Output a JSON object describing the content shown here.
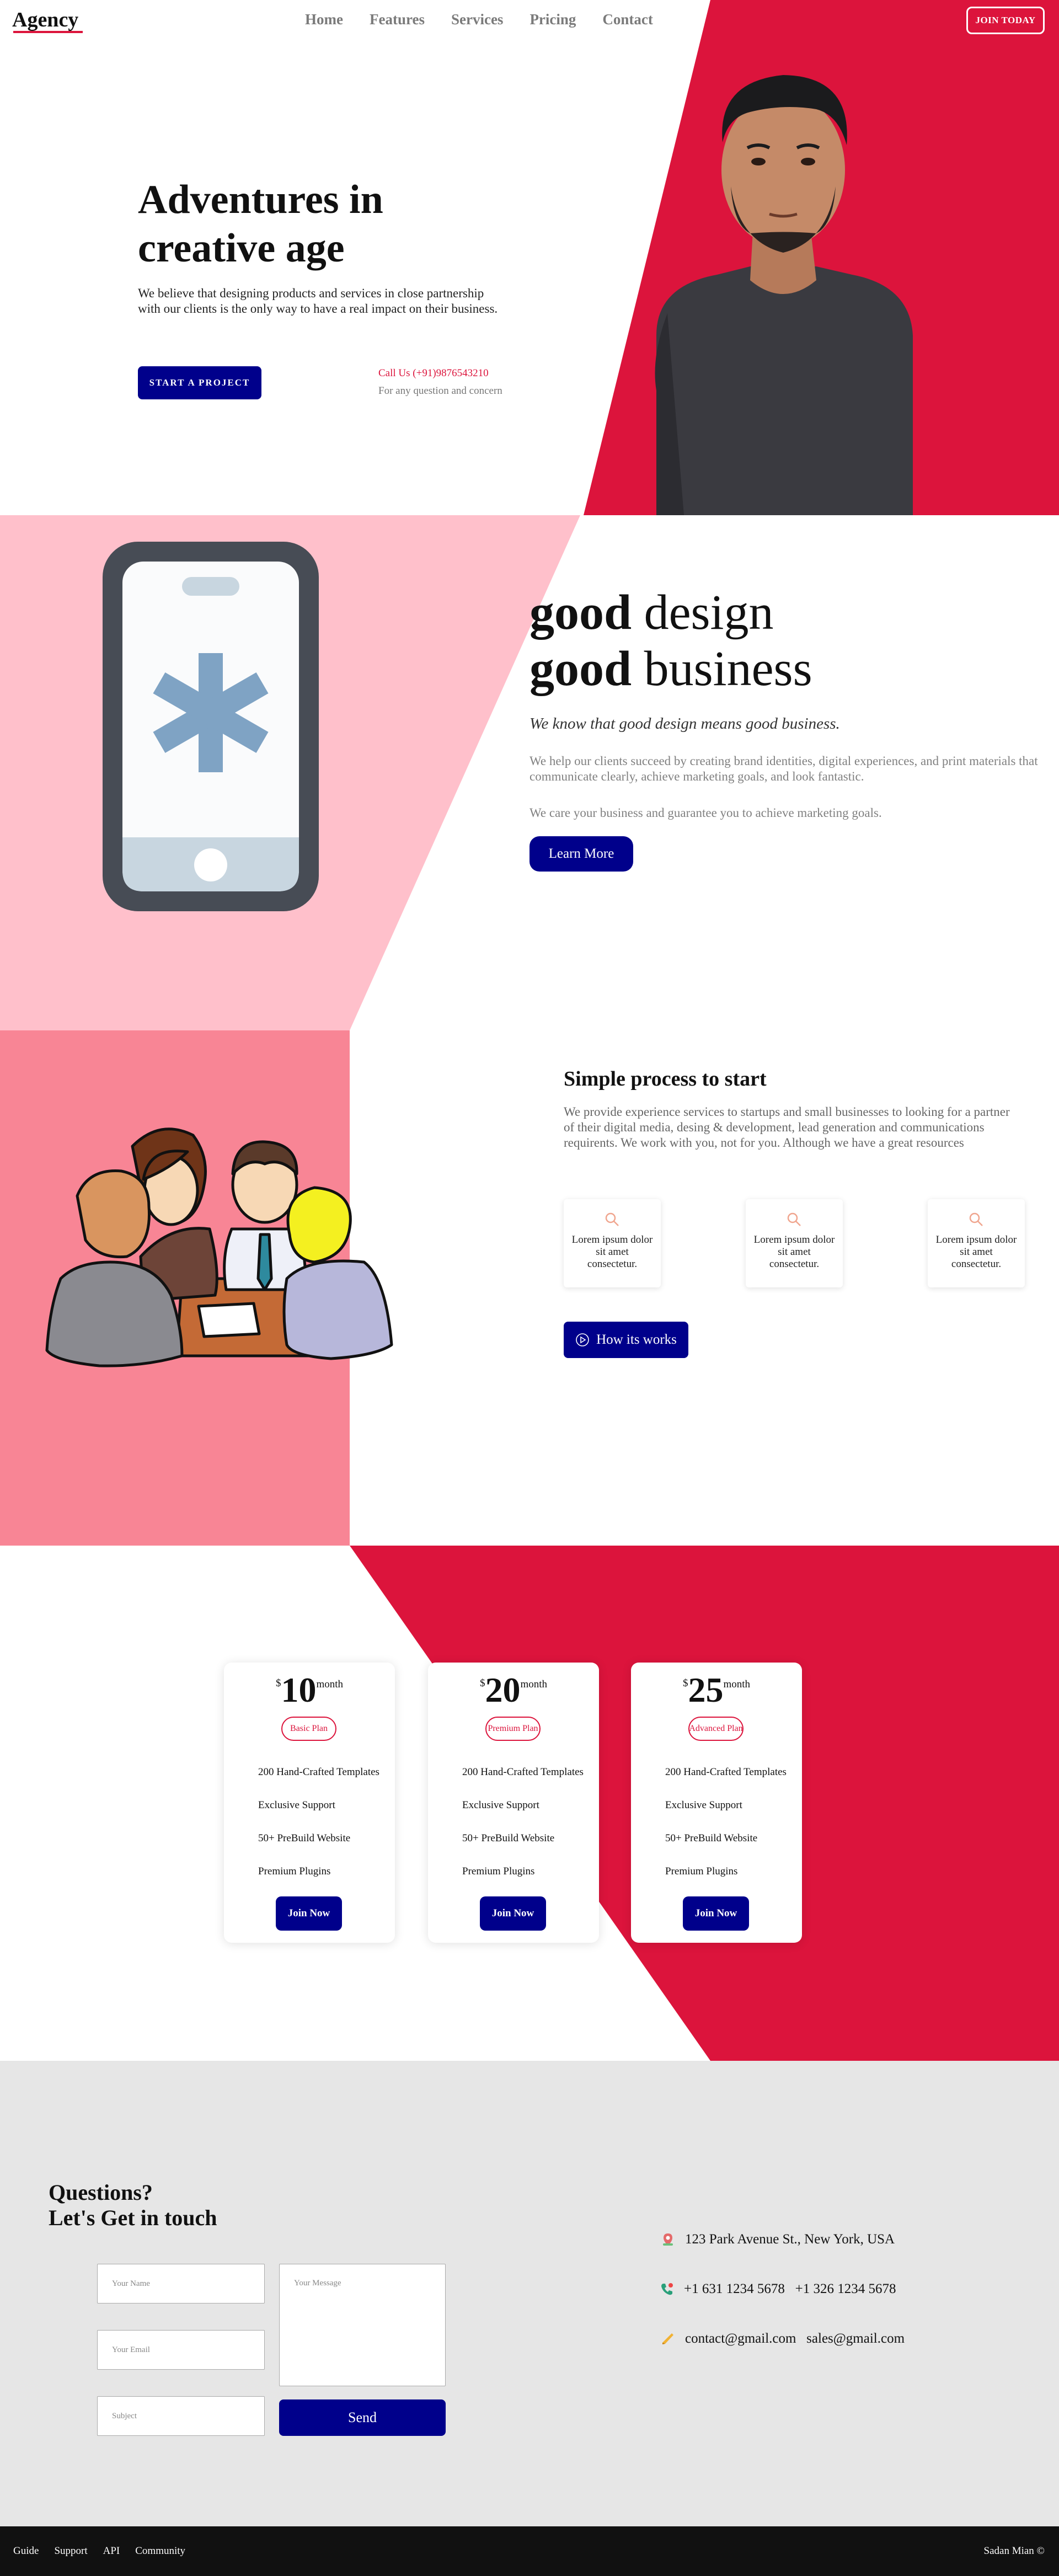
{
  "header": {
    "logo": "Agency",
    "nav": [
      "Home",
      "Features",
      "Services",
      "Pricing",
      "Contact"
    ],
    "cta": "JOIN TODAY"
  },
  "hero": {
    "title": "Adventures in creative age",
    "description": "We believe that designing products and services in close partnership with our clients is the only way to have a real impact on their business.",
    "button": "START A PROJECT",
    "call": "Call Us (+91)9876543210",
    "call_sub": "For any question and concern"
  },
  "design": {
    "line1_bold": "good",
    "line1": " design",
    "line2_bold": "good",
    "line2": " business",
    "subtitle": "We know that good design means good business.",
    "p1": "We help our clients succeed by creating brand identities, digital experiences, and print materials that communicate clearly, achieve marketing goals, and look fantastic.",
    "p2": "We care your business and guarantee you to achieve marketing goals.",
    "button": "Learn More"
  },
  "process": {
    "title": "Simple process to start",
    "description": "We provide experience services to startups and small businesses to looking for a partner of their digital media, desing & development, lead generation and communications requirents. We work with you, not for you. Although we have a great resources",
    "cards": [
      "Lorem ipsum dolor sit amet consectetur.",
      "Lorem ipsum dolor sit amet consectetur.",
      "Lorem ipsum dolor sit amet consectetur."
    ],
    "button": "How its works"
  },
  "pricing": {
    "plans": [
      {
        "currency": "$",
        "amount": "10",
        "period": "month",
        "name": "Basic Plan",
        "features": [
          "200 Hand-Crafted Templates",
          "Exclusive Support",
          "50+ PreBuild Website",
          "Premium Plugins"
        ],
        "button": "Join Now"
      },
      {
        "currency": "$",
        "amount": "20",
        "period": "month",
        "name": "Premium Plan",
        "features": [
          "200 Hand-Crafted Templates",
          "Exclusive Support",
          "50+ PreBuild Website",
          "Premium Plugins"
        ],
        "button": "Join Now"
      },
      {
        "currency": "$",
        "amount": "25",
        "period": "month",
        "name": "Advanced Plan",
        "features": [
          "200 Hand-Crafted Templates",
          "Exclusive Support",
          "50+ PreBuild Website",
          "Premium Plugins"
        ],
        "button": "Join Now"
      }
    ]
  },
  "contact": {
    "title1": "Questions?",
    "title2": "Let's Get in touch",
    "name_placeholder": "Your Name",
    "email_placeholder": "Your Email",
    "subject_placeholder": "Subject",
    "message_placeholder": "Your Message",
    "send": "Send",
    "address": "123 Park Avenue St., New York, USA",
    "phones": "+1 631 1234 5678   +1 326 1234 5678",
    "emails": "contact@gmail.com   sales@gmail.com"
  },
  "footer": {
    "links": [
      "Guide",
      "Support",
      "API",
      "Community"
    ],
    "copyright": "Sadan Mian ©"
  },
  "colors": {
    "accent": "#dc143c",
    "primary": "#00008b",
    "pink": "#ffc0cb",
    "pink_dark": "#f88595",
    "contact_bg": "#e6e6e6",
    "footer_bg": "#111111"
  },
  "icons": [
    "phone-illustration",
    "team-illustration",
    "person-photo",
    "search-icon",
    "play-icon",
    "location-icon",
    "phone-icon",
    "email-icon"
  ]
}
